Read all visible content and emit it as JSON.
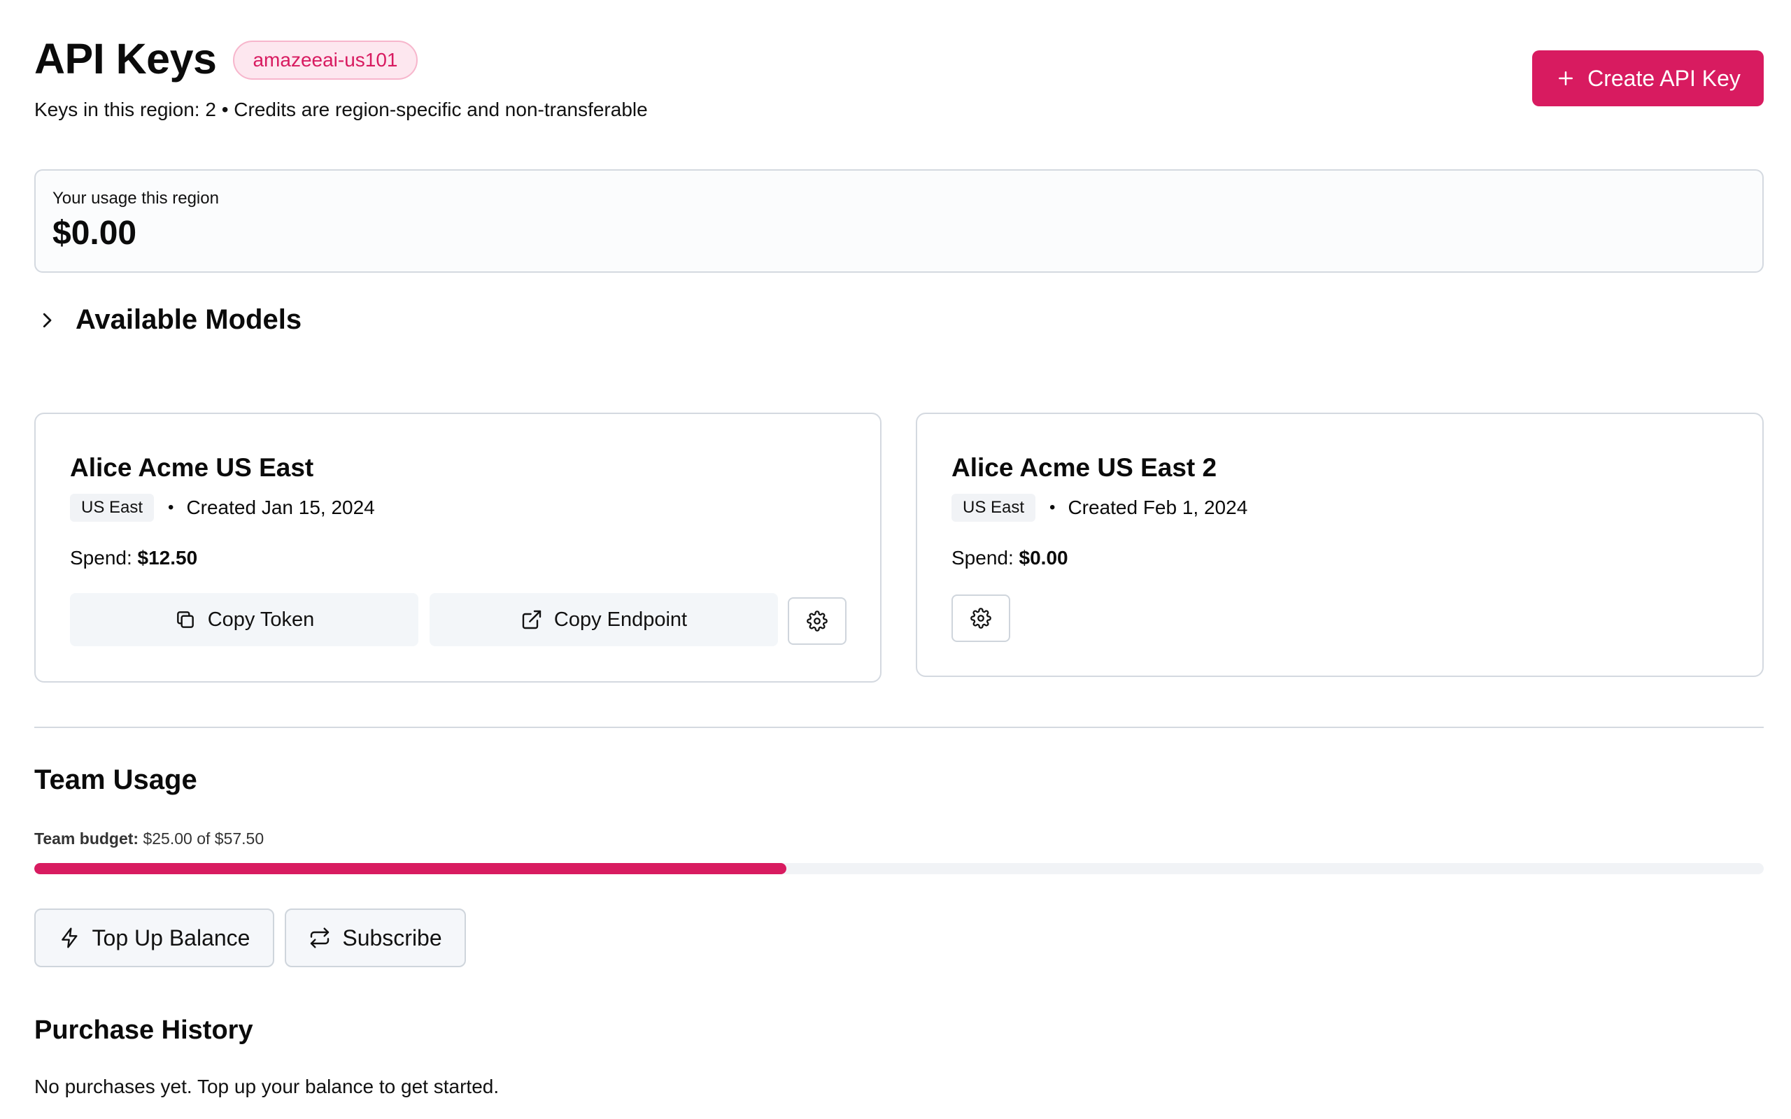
{
  "header": {
    "title": "API Keys",
    "region_badge": "amazeeai-us101",
    "subtitle": "Keys in this region: 2 • Credits are region-specific and non-transferable",
    "create_button_label": "Create API Key"
  },
  "usage": {
    "label": "Your usage this region",
    "value": "$0.00"
  },
  "models": {
    "title": "Available Models",
    "expanded": false
  },
  "keys": [
    {
      "name": "Alice Acme US East",
      "region": "US East",
      "created": "Created Jan 15, 2024",
      "spend_label": "Spend:",
      "spend_value": "$12.50",
      "copy_token_label": "Copy Token",
      "copy_endpoint_label": "Copy Endpoint"
    },
    {
      "name": "Alice Acme US East 2",
      "region": "US East",
      "created": "Created Feb 1, 2024",
      "spend_label": "Spend:",
      "spend_value": "$0.00"
    }
  ],
  "team_usage": {
    "title": "Team Usage",
    "budget_label": "Team budget:",
    "budget_text": "$25.00 of $57.50",
    "budget_used": 25.0,
    "budget_total": 57.5,
    "top_up_label": "Top Up Balance",
    "subscribe_label": "Subscribe"
  },
  "purchase_history": {
    "title": "Purchase History",
    "empty_text": "No purchases yet. Top up your balance to get started."
  },
  "colors": {
    "accent": "#d81b60",
    "badge_bg": "#fde7ef",
    "border": "#d4d9e0",
    "button_bg": "#f3f6f9"
  },
  "icons": {
    "create": "plus-icon",
    "models": "chevron-right-icon",
    "copy_token": "copy-icon",
    "copy_endpoint": "external-link-icon",
    "settings": "gear-icon",
    "top_up": "lightning-icon",
    "subscribe": "repeat-icon"
  }
}
